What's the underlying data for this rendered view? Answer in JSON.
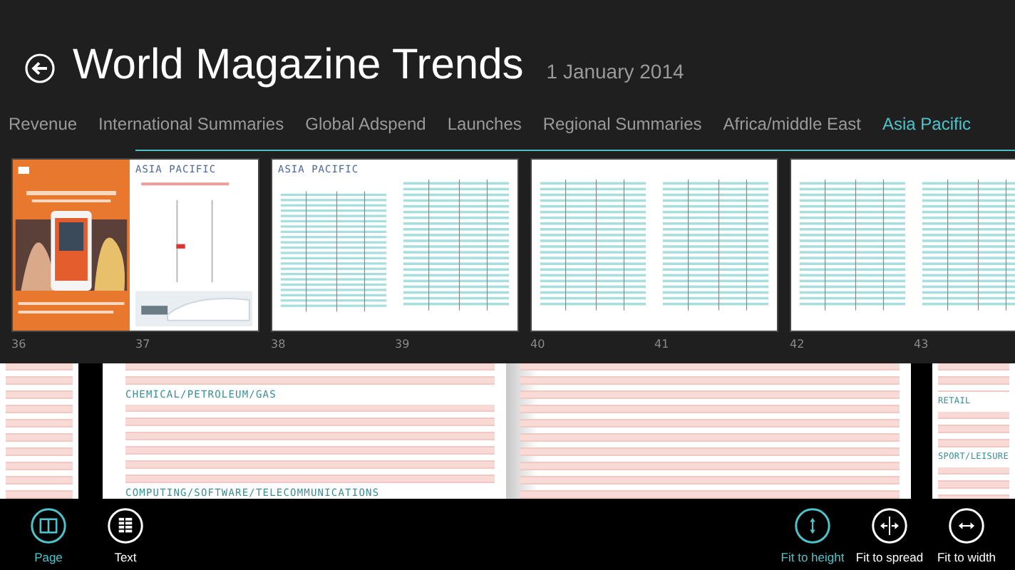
{
  "header": {
    "title": "World Magazine Trends",
    "date": "1 January 2014"
  },
  "tabs": [
    {
      "label": "Revenue",
      "selected": false
    },
    {
      "label": "International Summaries",
      "selected": false
    },
    {
      "label": "Global Adspend",
      "selected": false
    },
    {
      "label": "Launches",
      "selected": false
    },
    {
      "label": "Regional Summaries",
      "selected": false
    },
    {
      "label": "Africa/middle East",
      "selected": false
    },
    {
      "label": "Asia Pacific",
      "selected": true
    }
  ],
  "thumbnails": [
    {
      "page": "36",
      "kind": "cover"
    },
    {
      "page": "37",
      "kind": "title",
      "heading": "ASIA PACIFIC"
    },
    {
      "page": "38",
      "kind": "table",
      "heading": "ASIA PACIFIC"
    },
    {
      "page": "39",
      "kind": "table"
    },
    {
      "page": "40",
      "kind": "table"
    },
    {
      "page": "41",
      "kind": "table"
    },
    {
      "page": "42",
      "kind": "table"
    },
    {
      "page": "43",
      "kind": "table"
    }
  ],
  "document": {
    "pages": [
      {
        "kind": "plain"
      },
      {
        "kind": "sections",
        "headings": [
          "CHEMICAL/PETROLEUM/GAS",
          "COMPUTING/SOFTWARE/TELECOMMUNICATIONS"
        ]
      },
      {
        "kind": "plain"
      },
      {
        "kind": "sections",
        "headings": [
          "RETAIL",
          "SPORT/LEISURE"
        ]
      }
    ]
  },
  "app_bar": {
    "left": [
      {
        "label": "Page",
        "kind": "page",
        "selected": true
      },
      {
        "label": "Text",
        "kind": "text",
        "selected": false
      }
    ],
    "right": [
      {
        "label": "Fit to height",
        "kind": "height",
        "selected": true
      },
      {
        "label": "Fit to spread",
        "kind": "spread",
        "selected": false
      },
      {
        "label": "Fit to width",
        "kind": "width",
        "selected": false
      }
    ]
  }
}
